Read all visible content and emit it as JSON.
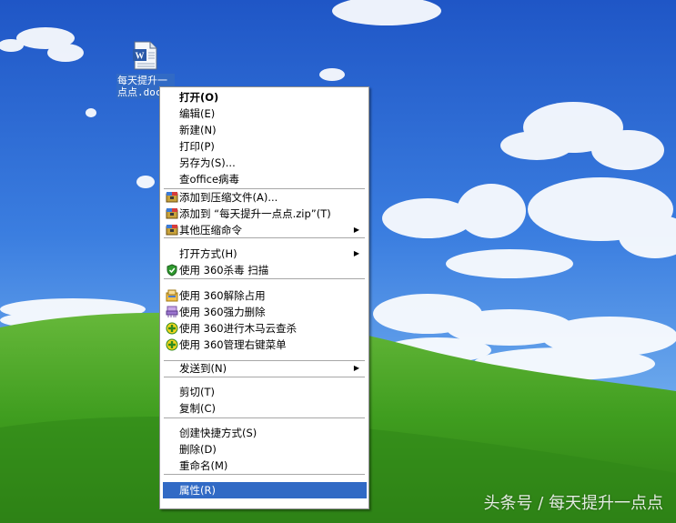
{
  "desktop_icon": {
    "label": "每天提升一\n点点.doc"
  },
  "menu": {
    "items": [
      {
        "label": "打开(O)",
        "bold": true
      },
      {
        "label": "编辑(E)"
      },
      {
        "label": "新建(N)"
      },
      {
        "label": "打印(P)"
      },
      {
        "label": "另存为(S)..."
      },
      {
        "label": "查office病毒"
      },
      {
        "label": "添加到压缩文件(A)...",
        "icon": "archive-icon"
      },
      {
        "label": "添加到 “每天提升一点点.zip”(T)",
        "icon": "archive-icon"
      },
      {
        "label": "其他压缩命令",
        "icon": "archive-icon",
        "submenu": true
      },
      {
        "label": "打开方式(H)",
        "submenu": true
      },
      {
        "label": "使用 360杀毒 扫描",
        "icon": "shield-icon"
      },
      {
        "label": "使用 360解除占用",
        "icon": "unlock-icon"
      },
      {
        "label": "使用 360强力删除",
        "icon": "shred-icon"
      },
      {
        "label": "使用 360进行木马云查杀",
        "icon": "360-icon"
      },
      {
        "label": "使用 360管理右键菜单",
        "icon": "360-icon"
      },
      {
        "label": "发送到(N)",
        "submenu": true
      },
      {
        "label": "剪切(T)"
      },
      {
        "label": "复制(C)"
      },
      {
        "label": "创建快捷方式(S)"
      },
      {
        "label": "删除(D)"
      },
      {
        "label": "重命名(M)"
      },
      {
        "label": "属性(R)",
        "highlighted": true
      }
    ]
  },
  "watermark": "头条号 / 每天提升一点点",
  "colors": {
    "highlight": "#316ac5",
    "sky": "#2f6fd8",
    "grass": "#3f9d1f"
  }
}
